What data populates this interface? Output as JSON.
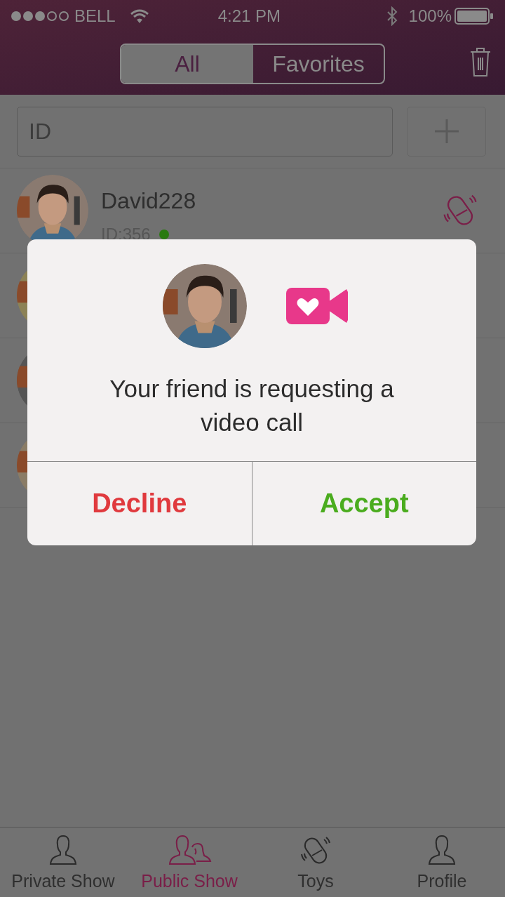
{
  "status_bar": {
    "carrier": "BELL",
    "signal_dots": [
      {
        "filled": true
      },
      {
        "filled": true
      },
      {
        "filled": true
      },
      {
        "filled": false
      },
      {
        "filled": false
      }
    ],
    "time": "4:21 PM",
    "battery": "100%"
  },
  "segments": [
    {
      "label": "All",
      "selected": true
    },
    {
      "label": "Favorites",
      "selected": false
    }
  ],
  "search": {
    "placeholder": "ID"
  },
  "contacts": [
    {
      "kind": "full",
      "name": "David228",
      "id": "ID:356",
      "online": true
    },
    {
      "kind": "covered"
    },
    {
      "kind": "covered"
    },
    {
      "kind": "covered"
    }
  ],
  "dialog": {
    "message": "Your friend is requesting a video call",
    "buttons": [
      {
        "label": "Decline",
        "kind": "decline"
      },
      {
        "label": "Accept",
        "kind": "accept"
      }
    ]
  },
  "tab_bar": [
    {
      "label": "Private Show",
      "kind": "person",
      "selected": false
    },
    {
      "label": "Public Show",
      "kind": "people",
      "selected": true
    },
    {
      "label": "Toys",
      "kind": "toy",
      "selected": false
    },
    {
      "label": "Profile",
      "kind": "person",
      "selected": false
    }
  ]
}
